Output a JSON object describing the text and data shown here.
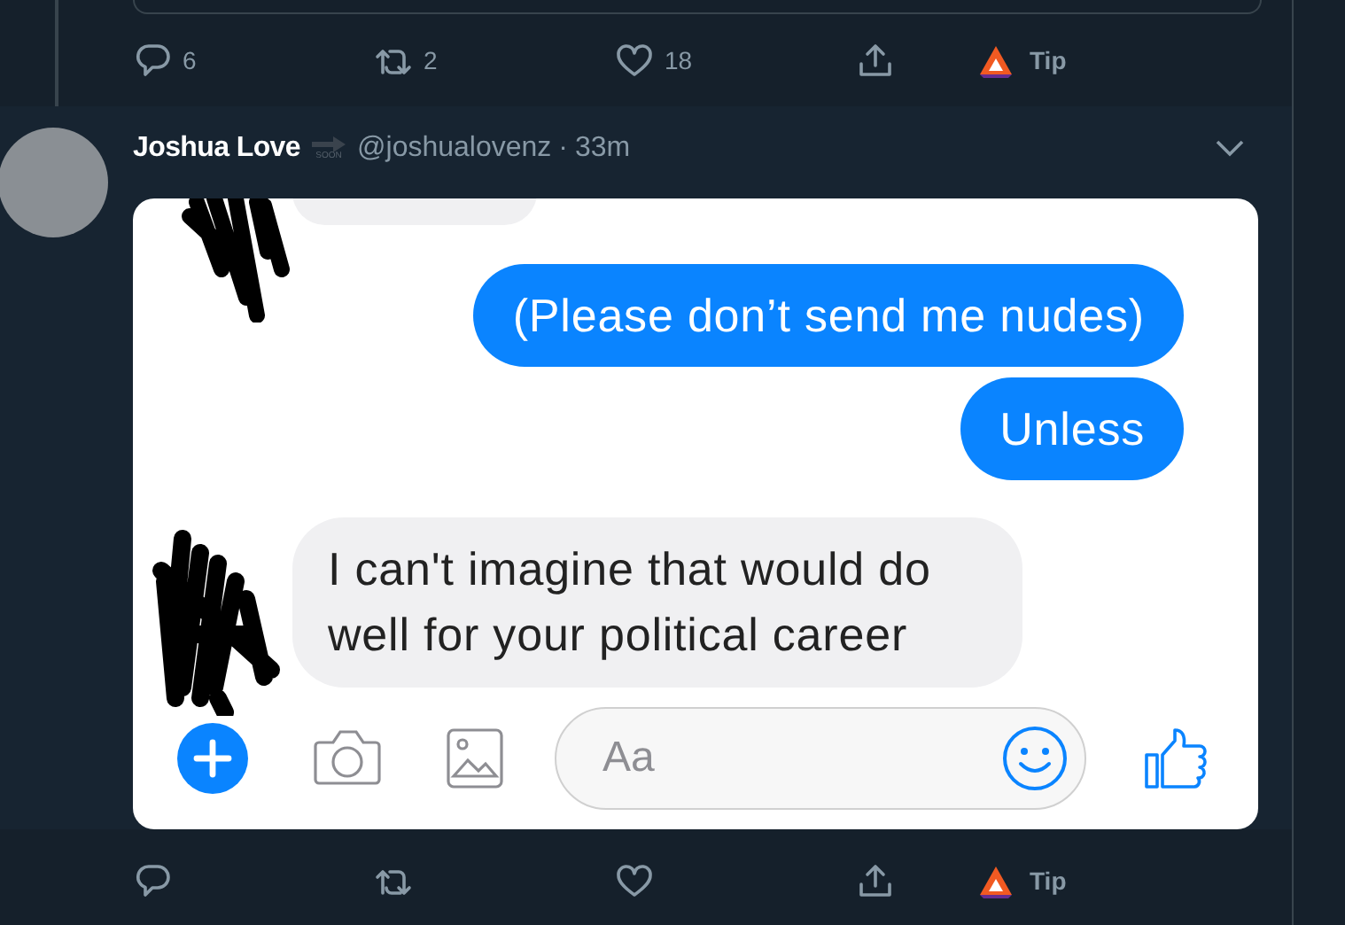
{
  "previous_tweet": {
    "actions": [
      {
        "kind": "reply",
        "count": "6"
      },
      {
        "kind": "retweet",
        "count": "2"
      },
      {
        "kind": "like",
        "count": "18"
      },
      {
        "kind": "share"
      },
      {
        "kind": "tip",
        "label": "Tip"
      }
    ]
  },
  "tweet": {
    "name": "Joshua Love",
    "badge": "SOON",
    "handle": "@joshualovenz",
    "separator": "·",
    "time": "33m",
    "screenshot": {
      "messages": [
        {
          "kind": "received"
        },
        {
          "kind": "sent",
          "text": "(Please don’t send me nudes)"
        },
        {
          "kind": "sent",
          "text": "Unless"
        },
        {
          "kind": "received",
          "text": "I can't imagine that would do well for your political career"
        }
      ],
      "composer": {
        "placeholder": "Aa"
      }
    },
    "actions": [
      {
        "kind": "reply"
      },
      {
        "kind": "retweet"
      },
      {
        "kind": "like"
      },
      {
        "kind": "share"
      },
      {
        "kind": "tip",
        "label": "Tip"
      }
    ]
  }
}
